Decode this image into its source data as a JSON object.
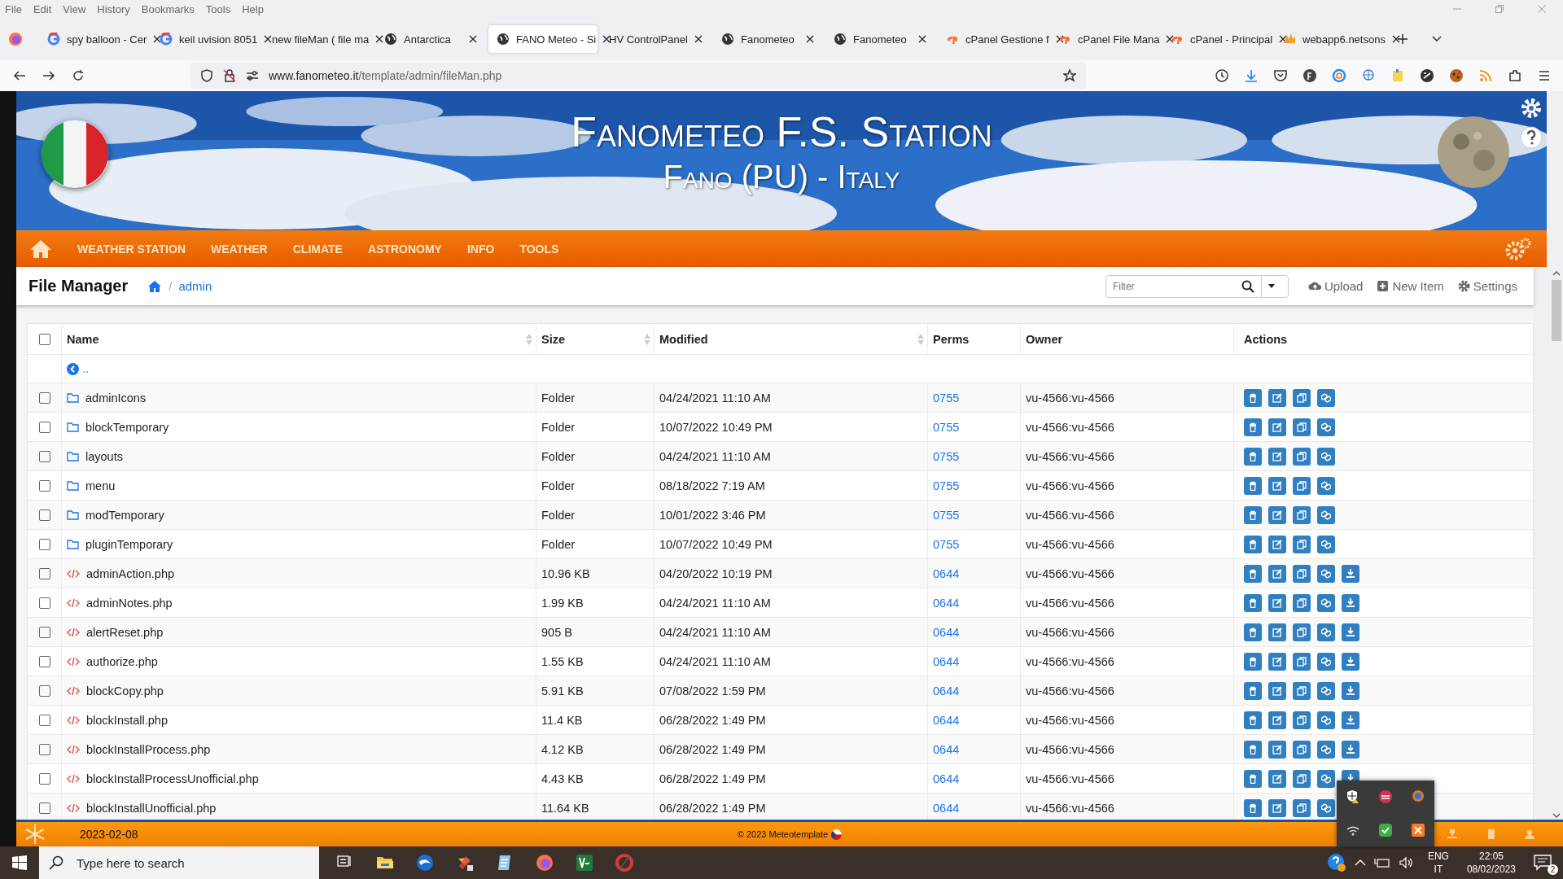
{
  "menu_bar": [
    "File",
    "Edit",
    "View",
    "History",
    "Bookmarks",
    "Tools",
    "Help"
  ],
  "tabs": [
    {
      "title": "spy balloon - Cer",
      "kind": "google",
      "selected": false
    },
    {
      "title": "keil uvision 8051",
      "kind": "google",
      "selected": false
    },
    {
      "title": "new fileMan ( file ma",
      "kind": "none",
      "selected": false
    },
    {
      "title": "Antarctica",
      "kind": "globe",
      "selected": false
    },
    {
      "title": "FANO Meteo - Si",
      "kind": "globe",
      "selected": true
    },
    {
      "title": "HV ControlPanel",
      "kind": "none",
      "selected": false
    },
    {
      "title": "Fanometeo",
      "kind": "globe",
      "selected": false
    },
    {
      "title": "Fanometeo",
      "kind": "globe",
      "selected": false
    },
    {
      "title": "cPanel Gestione f",
      "kind": "cpanel",
      "selected": false
    },
    {
      "title": "cPanel File Mana",
      "kind": "cpanel",
      "selected": false
    },
    {
      "title": "cPanel - Principal",
      "kind": "cpanel",
      "selected": false
    },
    {
      "title": "webapp6.netsons",
      "kind": "pma",
      "selected": false
    }
  ],
  "address_bar": {
    "host": "www.fanometeo.it",
    "path": "/template/admin/fileMan.php"
  },
  "banner": {
    "title": "Fanometeo F.S. Station",
    "subtitle": "Fano (PU) - Italy"
  },
  "nav": [
    "WEATHER STATION",
    "WEATHER",
    "CLIMATE",
    "ASTRONOMY",
    "INFO",
    "TOOLS"
  ],
  "file_manager": {
    "title": "File Manager",
    "breadcrumb_separator": "/",
    "breadcrumb": "admin",
    "filter": {
      "placeholder": "Filter"
    },
    "buttons": [
      {
        "label": "Upload",
        "kind": "upload"
      },
      {
        "label": "New Item",
        "kind": "new"
      },
      {
        "label": "Settings",
        "kind": "settings"
      }
    ]
  },
  "table": {
    "select_all": {
      "checked": false
    },
    "columns": [
      {
        "label": "Name",
        "sortable": true
      },
      {
        "label": "Size",
        "sortable": true
      },
      {
        "label": "Modified",
        "sortable": true
      },
      {
        "label": "Perms",
        "sortable": false
      },
      {
        "label": "Owner",
        "sortable": false
      },
      {
        "label": "Actions",
        "sortable": false
      }
    ],
    "parent_link": "..",
    "rows": [
      {
        "name": "adminIcons",
        "size": "Folder",
        "modified": "04/24/2021 11:10 AM",
        "perms": "0755",
        "owner": "vu-4566:vu-4566",
        "kind": "folder",
        "checked": false
      },
      {
        "name": "blockTemporary",
        "size": "Folder",
        "modified": "10/07/2022 10:49 PM",
        "perms": "0755",
        "owner": "vu-4566:vu-4566",
        "kind": "folder",
        "checked": false
      },
      {
        "name": "layouts",
        "size": "Folder",
        "modified": "04/24/2021 11:10 AM",
        "perms": "0755",
        "owner": "vu-4566:vu-4566",
        "kind": "folder",
        "checked": false
      },
      {
        "name": "menu",
        "size": "Folder",
        "modified": "08/18/2022 7:19 AM",
        "perms": "0755",
        "owner": "vu-4566:vu-4566",
        "kind": "folder",
        "checked": false
      },
      {
        "name": "modTemporary",
        "size": "Folder",
        "modified": "10/01/2022 3:46 PM",
        "perms": "0755",
        "owner": "vu-4566:vu-4566",
        "kind": "folder",
        "checked": false
      },
      {
        "name": "pluginTemporary",
        "size": "Folder",
        "modified": "10/07/2022 10:49 PM",
        "perms": "0755",
        "owner": "vu-4566:vu-4566",
        "kind": "folder",
        "checked": false
      },
      {
        "name": "adminAction.php",
        "size": "10.96 KB",
        "modified": "04/20/2022 10:19 PM",
        "perms": "0644",
        "owner": "vu-4566:vu-4566",
        "kind": "file",
        "checked": false
      },
      {
        "name": "adminNotes.php",
        "size": "1.99 KB",
        "modified": "04/24/2021 11:10 AM",
        "perms": "0644",
        "owner": "vu-4566:vu-4566",
        "kind": "file",
        "checked": false
      },
      {
        "name": "alertReset.php",
        "size": "905 B",
        "modified": "04/24/2021 11:10 AM",
        "perms": "0644",
        "owner": "vu-4566:vu-4566",
        "kind": "file",
        "checked": false
      },
      {
        "name": "authorize.php",
        "size": "1.55 KB",
        "modified": "04/24/2021 11:10 AM",
        "perms": "0644",
        "owner": "vu-4566:vu-4566",
        "kind": "file",
        "checked": false
      },
      {
        "name": "blockCopy.php",
        "size": "5.91 KB",
        "modified": "07/08/2022 1:59 PM",
        "perms": "0644",
        "owner": "vu-4566:vu-4566",
        "kind": "file",
        "checked": false
      },
      {
        "name": "blockInstall.php",
        "size": "11.4 KB",
        "modified": "06/28/2022 1:49 PM",
        "perms": "0644",
        "owner": "vu-4566:vu-4566",
        "kind": "file",
        "checked": false
      },
      {
        "name": "blockInstallProcess.php",
        "size": "4.12 KB",
        "modified": "06/28/2022 1:49 PM",
        "perms": "0644",
        "owner": "vu-4566:vu-4566",
        "kind": "file",
        "checked": false
      },
      {
        "name": "blockInstallProcessUnofficial.php",
        "size": "4.43 KB",
        "modified": "06/28/2022 1:49 PM",
        "perms": "0644",
        "owner": "vu-4566:vu-4566",
        "kind": "file",
        "checked": false
      },
      {
        "name": "blockInstallUnofficial.php",
        "size": "11.64 KB",
        "modified": "06/28/2022 1:49 PM",
        "perms": "0644",
        "owner": "vu-4566:vu-4566",
        "kind": "file",
        "checked": false
      }
    ]
  },
  "footer": {
    "date": "2023-02-08",
    "copyright": "© 2023 Meteotemplate"
  },
  "taskbar": {
    "search": {
      "placeholder": "Type here to search"
    },
    "language": "ENG",
    "layout": "IT",
    "time": "22:05",
    "date": "08/02/2023",
    "notifications": "2"
  }
}
